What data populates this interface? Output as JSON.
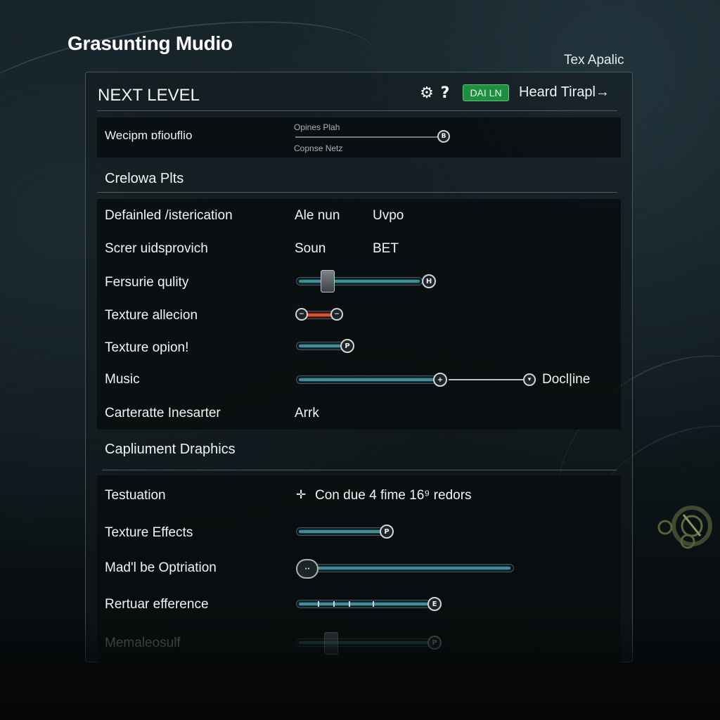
{
  "app_title": "Grasunting Mudio",
  "corner_label": "Tex Apalic",
  "header": {
    "title": "NEXT LEVEL",
    "gear_icon": "gear-icon",
    "help_icon": "help-icon",
    "help_glyph": "?",
    "badge": "DAI LN",
    "link": "Heard Tirapl→",
    "accent_green": "#1f8e3e"
  },
  "top_row": {
    "label": "Wecipm ɒfiouflio",
    "caption_top": "Opines  Plah",
    "caption_bottom": "Copnse  Netz",
    "knob_glyph": "B"
  },
  "sections": {
    "first": "Crelowa Plts",
    "second": "Capliument Draphics"
  },
  "rows": {
    "definition": {
      "label": "Defainled /isterication",
      "value1": "Ale nun",
      "value2": "Uvpo"
    },
    "screen": {
      "label": "Screr uidsprovich",
      "value1": "Soun",
      "value2": "BET"
    },
    "quality": {
      "label": "Fersurie qulity",
      "knob_glyph": "H"
    },
    "allocation": {
      "label": "Texture allecion",
      "accent": "#e0522a"
    },
    "option": {
      "label": "Texture opion!",
      "knob_glyph": "P"
    },
    "music": {
      "label": "Music",
      "trailing": "Docl|ine"
    },
    "carter": {
      "label": "Carteratte Inesarter",
      "value": "Arrk"
    },
    "testuation": {
      "label": "Testuation",
      "value": "Con due 4 fime 16⁹  redors"
    },
    "effects": {
      "label": "Texture Effects",
      "knob_glyph": "P"
    },
    "optimization": {
      "label": "Mad'l be Optriation",
      "knob_glyph": "··"
    },
    "reference": {
      "label": "Rertuar efference",
      "knob_glyph": "E"
    },
    "faded": {
      "label": "Memaleosulf",
      "knob_glyph": "P"
    }
  }
}
